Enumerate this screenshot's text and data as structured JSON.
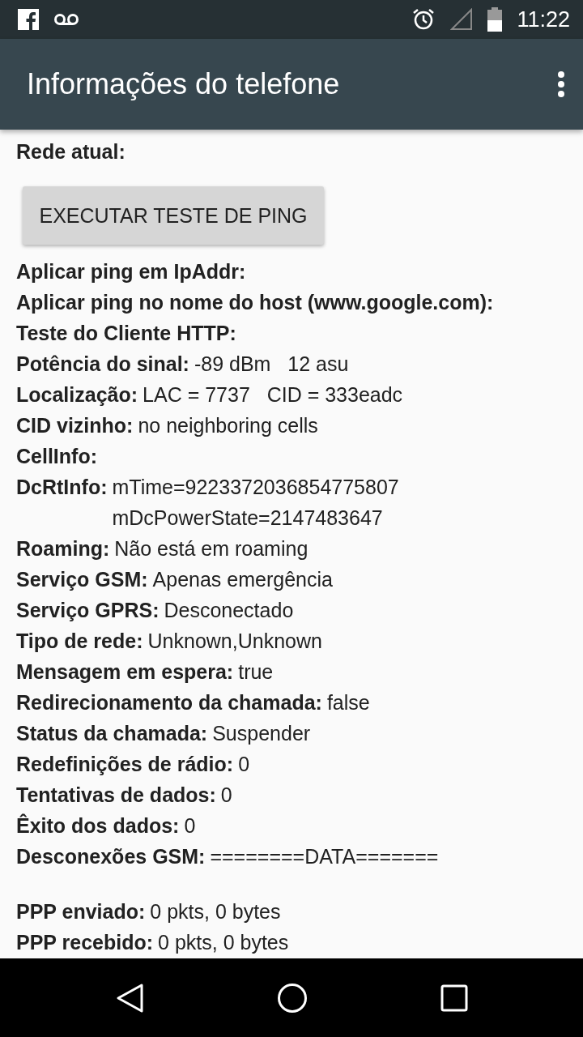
{
  "status_bar": {
    "time": "11:22"
  },
  "app_bar": {
    "title": "Informações do telefone"
  },
  "current_network": {
    "label": "Rede atual:"
  },
  "ping_button": {
    "label": "EXECUTAR TESTE DE PING"
  },
  "rows": [
    {
      "label": "Aplicar ping em IpAddr:",
      "lines": []
    },
    {
      "label": "Aplicar ping no nome do host (www.google.com):",
      "lines": []
    },
    {
      "label": "Teste do Cliente HTTP:",
      "lines": []
    },
    {
      "label": "Potência do sinal:",
      "lines": [
        "-89 dBm   12 asu"
      ]
    },
    {
      "label": "Localização:",
      "lines": [
        "LAC = 7737   CID = 333eadc"
      ]
    },
    {
      "label": "CID vizinho:",
      "lines": [
        "no neighboring cells"
      ]
    },
    {
      "label": "CellInfo:",
      "lines": []
    },
    {
      "label": "DcRtInfo:",
      "lines": [
        "mTime=9223372036854775807",
        "mDcPowerState=2147483647"
      ]
    },
    {
      "label": "Roaming:",
      "lines": [
        "Não está em roaming"
      ]
    },
    {
      "label": "Serviço GSM:",
      "lines": [
        "Apenas emergência"
      ]
    },
    {
      "label": "Serviço GPRS:",
      "lines": [
        "Desconectado"
      ]
    },
    {
      "label": "Tipo de rede:",
      "lines": [
        "Unknown,Unknown"
      ]
    },
    {
      "label": "Mensagem em espera:",
      "lines": [
        "true"
      ]
    },
    {
      "label": "Redirecionamento da chamada:",
      "lines": [
        "false"
      ]
    },
    {
      "label": "Status da chamada:",
      "lines": [
        "Suspender"
      ]
    },
    {
      "label": "Redefinições de rádio:",
      "lines": [
        "0"
      ]
    },
    {
      "label": "Tentativas de dados:",
      "lines": [
        "0"
      ]
    },
    {
      "label": "Êxito dos dados:",
      "lines": [
        "0"
      ]
    },
    {
      "label": "Desconexões GSM:",
      "lines": [
        "========DATA======="
      ]
    }
  ],
  "rows_after_gap": [
    {
      "label": "PPP enviado:",
      "lines": [
        "0 pkts, 0 bytes"
      ]
    },
    {
      "label": "PPP recebido:",
      "lines": [
        "0 pkts, 0 bytes"
      ]
    }
  ]
}
